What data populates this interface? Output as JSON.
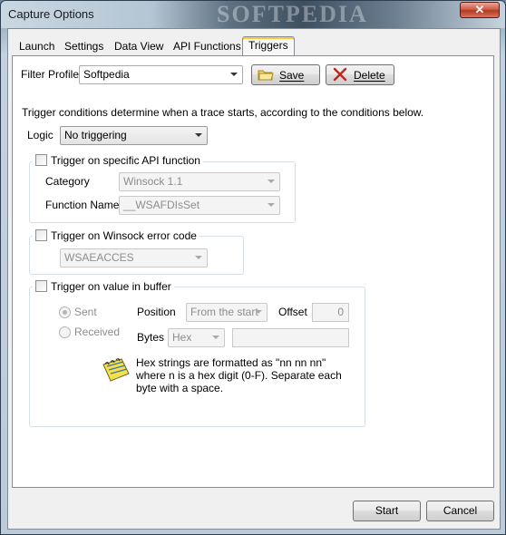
{
  "window": {
    "title": "Capture Options",
    "close_glyph": "✕",
    "watermark": "SOFTPEDIA"
  },
  "tabs": [
    {
      "label": "Launch"
    },
    {
      "label": "Settings"
    },
    {
      "label": "Data View"
    },
    {
      "label": "API Functions"
    },
    {
      "label": "Triggers"
    }
  ],
  "active_tab": "Triggers",
  "filter_profile": {
    "label": "Filter Profile",
    "value": "Softpedia",
    "save_label": "Save",
    "delete_label": "Delete"
  },
  "description": "Trigger conditions determine when a trace starts, according to the conditions below.",
  "logic": {
    "label": "Logic",
    "value": "No triggering"
  },
  "api_trigger": {
    "checkbox_label": "Trigger on specific API function",
    "checked": false,
    "category_label": "Category",
    "category_value": "Winsock 1.1",
    "function_label": "Function Name",
    "function_value": "__WSAFDIsSet"
  },
  "winsock_trigger": {
    "checkbox_label": "Trigger on Winsock error code",
    "checked": false,
    "error_value": "WSAEACCES"
  },
  "buffer_trigger": {
    "checkbox_label": "Trigger on value in buffer",
    "checked": false,
    "sent_label": "Sent",
    "received_label": "Received",
    "sent_selected": true,
    "position_label": "Position",
    "position_value": "From the start",
    "offset_label": "Offset",
    "offset_value": "0",
    "bytes_label": "Bytes",
    "bytes_format": "Hex",
    "bytes_value": "",
    "hint": "Hex strings are formatted as \"nn nn nn\" where n is a hex digit (0-F). Separate each byte with a space.",
    "hint_icon": "notepad-hint-icon"
  },
  "footer": {
    "start_label": "Start",
    "cancel_label": "Cancel"
  }
}
